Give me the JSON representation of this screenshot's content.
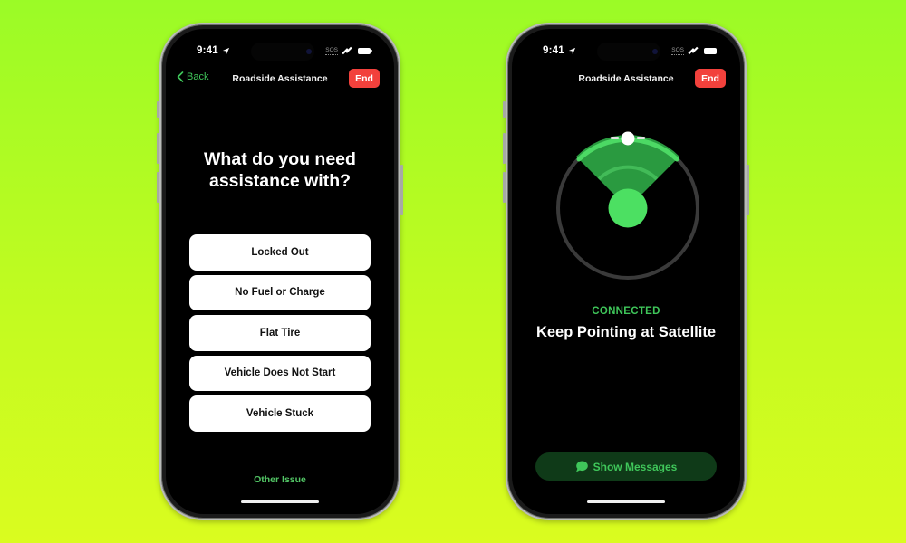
{
  "colors": {
    "accent_green": "#3fc65a",
    "end_red": "#f2413c",
    "background_top": "#9bfb26",
    "background_bottom": "#dafc1f"
  },
  "phones": [
    {
      "status": {
        "time": "9:41",
        "sos": "SOS",
        "icons": [
          "location-arrow-icon",
          "satellite-icon",
          "battery-icon"
        ]
      },
      "nav": {
        "back_label": "Back",
        "title": "Roadside Assistance",
        "end_label": "End"
      },
      "question": "What do you need assistance with?",
      "options": [
        {
          "label": "Locked Out"
        },
        {
          "label": "No Fuel or Charge"
        },
        {
          "label": "Flat Tire"
        },
        {
          "label": "Vehicle Does Not Start"
        },
        {
          "label": "Vehicle Stuck"
        }
      ],
      "other_issue_label": "Other Issue"
    },
    {
      "status": {
        "time": "9:41",
        "sos": "SOS",
        "icons": [
          "location-arrow-icon",
          "satellite-icon",
          "battery-icon"
        ]
      },
      "nav": {
        "title": "Roadside Assistance",
        "end_label": "End"
      },
      "connection_status": "CONNECTED",
      "instruction": "Keep Pointing at Satellite",
      "show_messages_label": "Show Messages",
      "show_messages_icon": "message-bubble-icon"
    }
  ]
}
